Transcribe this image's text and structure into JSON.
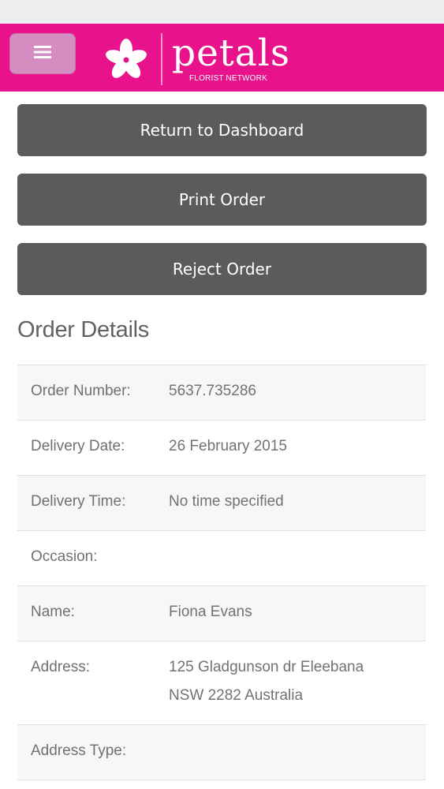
{
  "header": {
    "brand_name": "petals",
    "brand_subtitle": "FLORIST NETWORK",
    "brand_color": "#e8138a"
  },
  "actions": {
    "return_label": "Return to Dashboard",
    "print_label": "Print Order",
    "reject_label": "Reject Order"
  },
  "order": {
    "section_title": "Order Details",
    "rows": [
      {
        "label": "Order Number:",
        "value": "5637.735286"
      },
      {
        "label": "Delivery Date:",
        "value": "26 February 2015"
      },
      {
        "label": "Delivery Time:",
        "value": "No time specified"
      },
      {
        "label": "Occasion:",
        "value": ""
      },
      {
        "label": "Name:",
        "value": "Fiona Evans"
      },
      {
        "label": "Address:",
        "value_line1": "125 Gladgunson dr Eleebana",
        "value_line2": "NSW 2282 Australia"
      },
      {
        "label": "Address Type:",
        "value": ""
      }
    ]
  },
  "icons": {
    "menu": "hamburger-menu-icon",
    "logo": "flower-logo-icon"
  }
}
